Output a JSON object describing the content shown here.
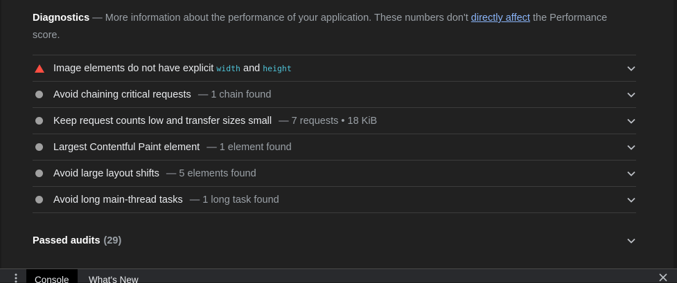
{
  "diagnostics": {
    "title": "Diagnostics",
    "dash": " — ",
    "text_before_link": "More information about the performance of your application. These numbers don't ",
    "link_text": "directly affect",
    "text_after_link": " the Performance score."
  },
  "audits": [
    {
      "status": "fail",
      "label_pre": "Image elements do not have explicit ",
      "code1": "width",
      "label_mid": " and ",
      "code2": "height",
      "detail": ""
    },
    {
      "status": "info",
      "label": "Avoid chaining critical requests",
      "detail": "— 1 chain found"
    },
    {
      "status": "info",
      "label": "Keep request counts low and transfer sizes small",
      "detail": "— 7 requests • 18 KiB"
    },
    {
      "status": "info",
      "label": "Largest Contentful Paint element",
      "detail": "— 1 element found"
    },
    {
      "status": "info",
      "label": "Avoid large layout shifts",
      "detail": "— 5 elements found"
    },
    {
      "status": "info",
      "label": "Avoid long main-thread tasks",
      "detail": "— 1 long task found"
    }
  ],
  "passed": {
    "title": "Passed audits",
    "count": "(29)"
  },
  "drawer": {
    "tabs": [
      {
        "label": "Console",
        "active": true
      },
      {
        "label": "What's New",
        "active": false
      }
    ]
  },
  "colors": {
    "fail": "#ff4e42",
    "info": "#a0a0a0",
    "link": "#8ab4f8",
    "code": "#4fc3d8"
  },
  "icons": {
    "fail": "warning-triangle-icon",
    "info": "gray-circle-icon",
    "expand": "chevron-down-icon",
    "menu": "kebab-menu-icon",
    "close": "close-icon"
  }
}
